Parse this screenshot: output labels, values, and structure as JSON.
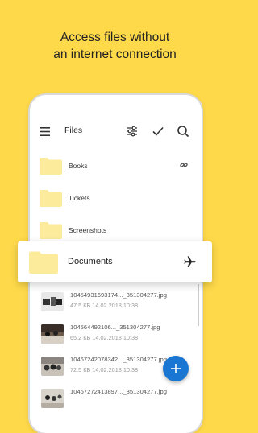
{
  "headline": {
    "line1": "Access files without",
    "line2": "an internet connection"
  },
  "appbar": {
    "title": "Files",
    "icons": [
      "menu-icon",
      "filter-icon",
      "check-icon",
      "search-icon"
    ]
  },
  "folders": [
    {
      "label": "Books",
      "icon": "link-icon"
    },
    {
      "label": "Tickets"
    },
    {
      "label": "Screenshots"
    }
  ],
  "documents_card": {
    "label": "Documents",
    "icon": "airplane-icon"
  },
  "files": [
    {
      "name": "10454931693174..._351304277.jpg",
      "meta": "47.5 КБ 14.02.2018 10:38"
    },
    {
      "name": "104564492106..._351304277.jpg",
      "meta": "65.2 КБ 14.02.2018 10:38"
    },
    {
      "name": "10467242078342..._351304277.jpg",
      "meta": "72.5 КБ 14.02.2018 10:38"
    },
    {
      "name": "10467272413897..._351304277.jpg",
      "meta": ""
    }
  ],
  "colors": {
    "background": "#FED94A",
    "folder": "#FDEB9C",
    "fab": "#1976D2"
  }
}
